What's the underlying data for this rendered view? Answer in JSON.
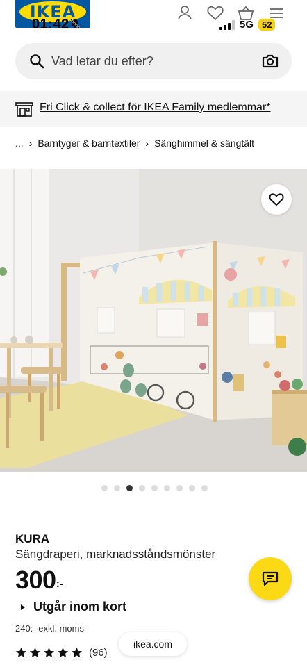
{
  "status_bar": {
    "time": "01:42",
    "network": "5G",
    "battery": "52"
  },
  "header": {
    "logo_text": "IKEA",
    "icons": [
      "profile-icon",
      "heart-icon",
      "shopping-bag-icon",
      "menu-icon"
    ]
  },
  "search": {
    "placeholder": "Vad letar du efter?"
  },
  "promo": {
    "text": "Fri Click & collect för IKEA Family medlemmar*"
  },
  "breadcrumb": {
    "ellipsis": "...",
    "items": [
      "Barntyger & barntextiler",
      "Sänghimmel & sängtält"
    ]
  },
  "carousel": {
    "count": 9,
    "active_index": 2
  },
  "product": {
    "brand": "KURA",
    "description": "Sängdraperi, marknadsståndsmönster",
    "price": "300",
    "price_suffix": ":-",
    "availability": "Utgår inom kort",
    "price_ex_vat": "240:- exkl. moms",
    "rating_stars": 5,
    "review_count": "(96)"
  },
  "footer": {
    "domain": "ikea.com"
  },
  "colors": {
    "ikea_blue": "#0058a3",
    "ikea_yellow": "#ffdb00",
    "chat_button": "#fbd914"
  }
}
